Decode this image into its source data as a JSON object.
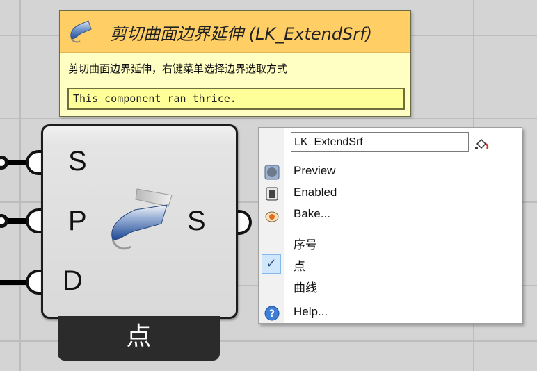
{
  "tooltip": {
    "title": "剪切曲面边界延伸 (LK_ExtendSrf)",
    "description": "剪切曲面边界延伸，右键菜单选择边界选取方式",
    "message": "This component ran thrice."
  },
  "component": {
    "inputs": [
      "S",
      "P",
      "D"
    ],
    "outputs": [
      "S"
    ],
    "nickname": "点"
  },
  "context_menu": {
    "name_value": "LK_ExtendSrf",
    "items": [
      {
        "label": "Preview",
        "icon": "preview-icon"
      },
      {
        "label": "Enabled",
        "icon": "enabled-icon"
      },
      {
        "label": "Bake...",
        "icon": "bake-icon"
      },
      {
        "label": "序号",
        "checked": false
      },
      {
        "label": "点",
        "checked": true
      },
      {
        "label": "曲线",
        "checked": false
      },
      {
        "label": "Help...",
        "icon": "help-icon"
      }
    ]
  }
}
